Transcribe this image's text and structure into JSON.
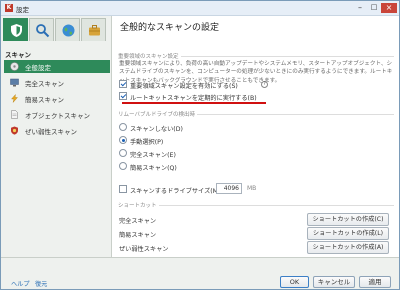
{
  "window": {
    "title": "設定",
    "app_icon": "K",
    "minimize": "–",
    "maximize": "□",
    "close": "×"
  },
  "sidebar": {
    "tabs": [
      {
        "icon": "shield-icon"
      },
      {
        "icon": "magnifier-icon"
      },
      {
        "icon": "globe-icon"
      },
      {
        "icon": "briefcase-icon"
      }
    ],
    "section_title": "スキャン",
    "items": [
      {
        "label": "全般設定",
        "icon": "disc-icon",
        "active": true
      },
      {
        "label": "完全スキャン",
        "icon": "computer-icon"
      },
      {
        "label": "簡易スキャン",
        "icon": "bolt-icon"
      },
      {
        "label": "オブジェクトスキャン",
        "icon": "file-icon"
      },
      {
        "label": "ぜい弱性スキャン",
        "icon": "shield-bug-icon"
      }
    ]
  },
  "main": {
    "title": "全般的なスキャンの設定",
    "important_group": "重要領域のスキャン設定",
    "description": "重要領域スキャンにより、負荷の高い自動アップデートやシステムメモリ、スタートアップオブジェクト、システムドライブのスキャンを、コンピューターの処理が少ないときにのみ実行するようにできます。ルートキットスキャンもバックグラウンドで実行させることもできます。",
    "options": [
      {
        "label": "重要領域スキャン設定を有効にする(S)",
        "checked": true
      },
      {
        "label": "ルートキットスキャンを定期的に実行する(B)",
        "checked": true
      }
    ],
    "removable_group": "リムーバブルドライブの検出時",
    "radios": [
      {
        "label": "スキャンしない(D)",
        "checked": false
      },
      {
        "label": "手動選択(P)",
        "checked": true
      },
      {
        "label": "完全スキャン(E)",
        "checked": false
      },
      {
        "label": "簡易スキャン(Q)",
        "checked": false
      }
    ],
    "max_drive_label": "スキャンするドライブサイズ(M)：",
    "max_drive_value": "4096",
    "max_drive_unit": "MB",
    "shortcut_group": "ショートカット",
    "shortcuts": [
      {
        "label": "完全スキャン",
        "button": "ショートカットの作成(C)"
      },
      {
        "label": "簡易スキャン",
        "button": "ショートカットの作成(L)"
      },
      {
        "label": "ぜい弱性スキャン",
        "button": "ショートカットの作成(A)"
      }
    ]
  },
  "footer": {
    "help": "ヘルプ",
    "restore": "復元",
    "ok": "OK",
    "cancel": "キャンセル",
    "apply": "適用"
  },
  "colors": {
    "accent": "#2e8a5a",
    "highlight_underline": "#d01010"
  }
}
